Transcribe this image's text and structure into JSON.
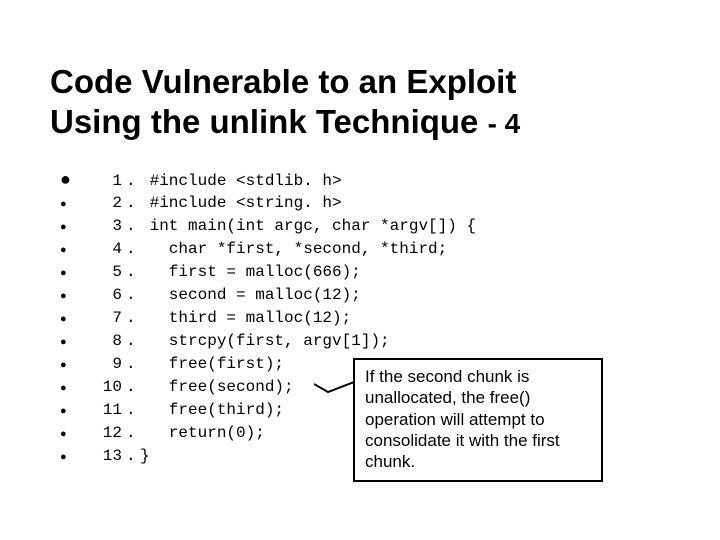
{
  "title_line1": "Code Vulnerable to an Exploit",
  "title_line2_main": "Using the unlink Technique",
  "title_line2_suffix": " - 4",
  "code_lines": [
    {
      "n": " 1",
      "text": "#include <stdlib. h>"
    },
    {
      "n": " 2",
      "text": "#include <string. h>"
    },
    {
      "n": " 3",
      "text": "int main(int argc, char *argv[]) {"
    },
    {
      "n": " 4",
      "text": "  char *first, *second, *third;"
    },
    {
      "n": " 5",
      "text": "  first = malloc(666);"
    },
    {
      "n": " 6",
      "text": "  second = malloc(12);"
    },
    {
      "n": " 7",
      "text": "  third = malloc(12);"
    },
    {
      "n": " 8",
      "text": "  strcpy(first, argv[1]);"
    },
    {
      "n": " 9",
      "text": "  free(first);"
    },
    {
      "n": "10",
      "text": "  free(second);"
    },
    {
      "n": "11",
      "text": "  free(third);"
    },
    {
      "n": "12",
      "text": "  return(0);"
    },
    {
      "n": "13",
      "text": "}",
      "nogap": true
    }
  ],
  "callout_text": "If the second chunk is unallocated, the free() operation will attempt to consolidate it with the first chunk."
}
